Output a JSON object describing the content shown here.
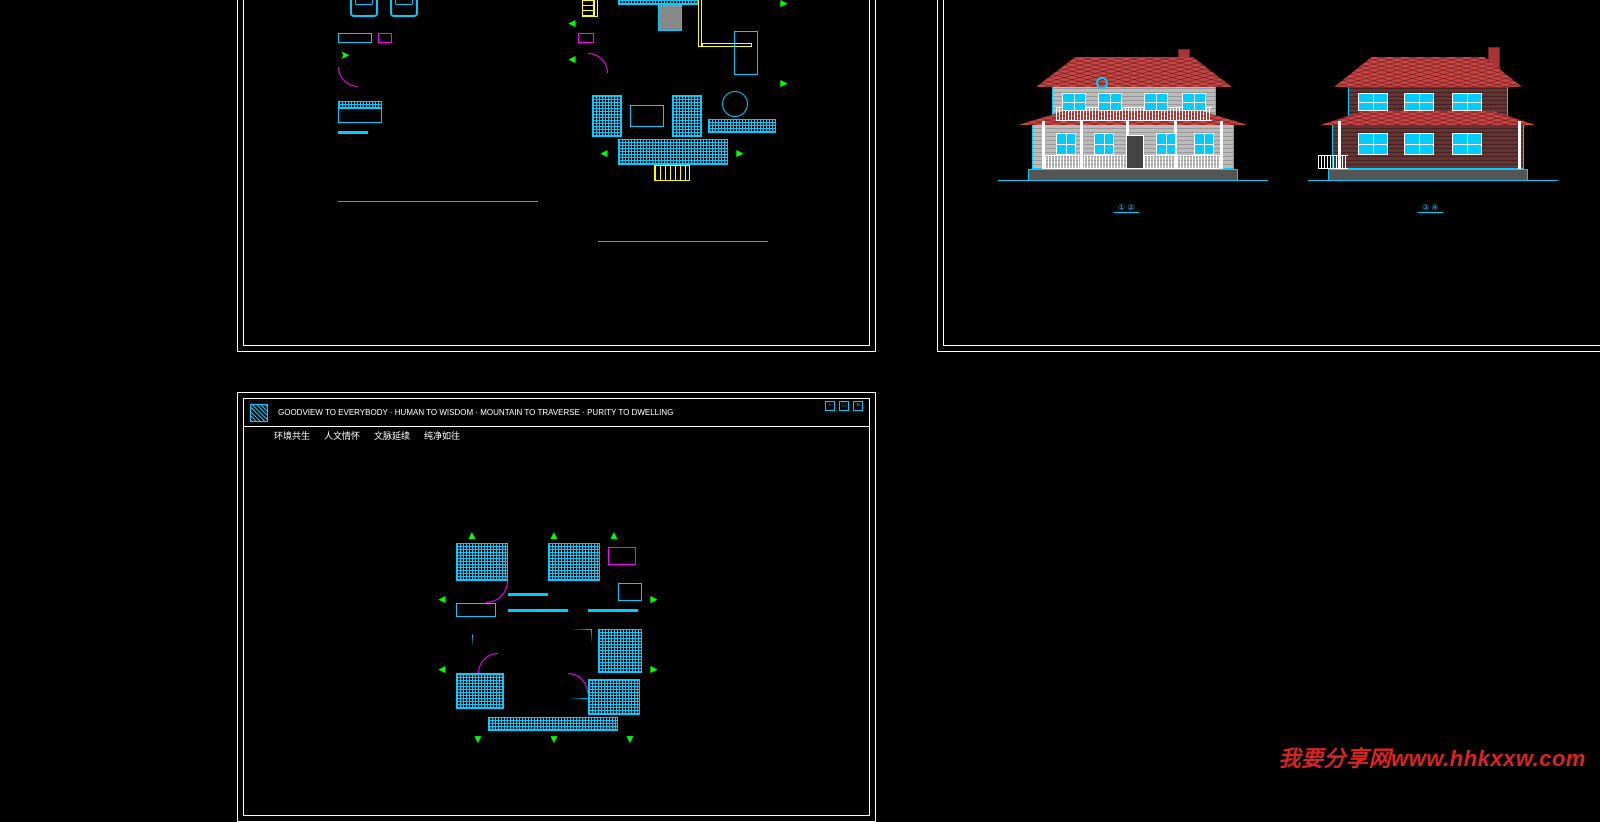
{
  "watermark": "我要分享网www.hhkxxw.com",
  "titleblock": {
    "small_text": "GOODVIEW TO EVERYBODY · HUMAN TO WISDOM · MOUNTAIN TO TRAVERSE · PURITY TO DWELLING",
    "nav": [
      "环境共生",
      "人文情怀",
      "文脉延续",
      "纯净如往"
    ]
  },
  "sheets": {
    "plan1": {
      "label_left": "",
      "label_right": ""
    },
    "plan2": {
      "label": ""
    },
    "elev": {
      "label_left": "① ②",
      "label_right": "③ ④"
    }
  }
}
